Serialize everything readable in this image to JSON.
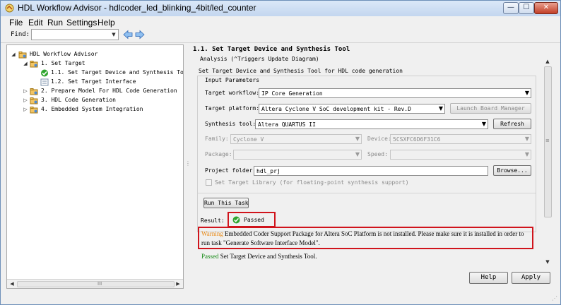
{
  "window": {
    "title": "HDL Workflow Advisor - hdlcoder_led_blinking_4bit/led_counter",
    "minimize_glyph": "—",
    "maximize_glyph": "☐",
    "close_glyph": "✕"
  },
  "menu": [
    "File",
    "Edit",
    "Run",
    "Settings",
    "Help"
  ],
  "find": {
    "label": "Find:",
    "value": "",
    "back_icon": "arrow-left-icon",
    "forward_icon": "arrow-right-icon"
  },
  "tree": [
    {
      "label": "HDL Workflow Advisor",
      "expander": "◢",
      "icon": "folder-icon"
    },
    {
      "label": "1. Set Target",
      "expander": "◢",
      "icon": "folder-icon"
    },
    {
      "label": "1.1. Set Target Device and Synthesis Tool",
      "expander": "",
      "icon": "check-passed-icon"
    },
    {
      "label": "1.2. Set Target Interface",
      "expander": "",
      "icon": "task-icon"
    },
    {
      "label": "2. Prepare Model For HDL Code Generation",
      "expander": "▷",
      "icon": "folder-icon"
    },
    {
      "label": "3. HDL Code Generation",
      "expander": "▷",
      "icon": "folder-icon"
    },
    {
      "label": "4. Embedded System Integration",
      "expander": "▷",
      "icon": "folder-icon"
    }
  ],
  "content": {
    "heading": "1.1. Set Target Device and Synthesis Tool",
    "analysis": "Analysis (^Triggers Update Diagram)",
    "description": "Set Target Device and Synthesis Tool for HDL code generation",
    "input_params_title": "Input Parameters",
    "target_workflow_label": "Target workflow:",
    "target_workflow_value": "IP Core Generation",
    "target_platform_label": "Target platform:",
    "target_platform_value": "Altera Cyclone V SoC development kit - Rev.D",
    "launch_board_manager": "Launch Board Manager",
    "synthesis_tool_label": "Synthesis tool:",
    "synthesis_tool_value": "Altera QUARTUS II",
    "refresh": "Refresh",
    "family_label": "Family:",
    "family_value": "Cyclone V",
    "device_label": "Device:",
    "device_value": "5CSXFC6D6F31C6",
    "package_label": "Package:",
    "package_value": "",
    "speed_label": "Speed:",
    "speed_value": "",
    "project_folder_label": "Project folder:",
    "project_folder_value": "hdl_prj",
    "browse": "Browse...",
    "set_target_library": "Set Target Library (for floating-point synthesis support)",
    "run_task": "Run This Task",
    "result_label": "Result:",
    "result_value": "Passed",
    "warning_word": "Warning",
    "warning_text": "Embedded Coder Support Package for Altera SoC Platform is not installed. Please make sure it is installed in order to run task \"Generate Software Interface Model\".",
    "passed_word": "Passed",
    "passed_text": "Set Target Device and Synthesis Tool."
  },
  "buttons": {
    "help": "Help",
    "apply": "Apply"
  },
  "scroll": {
    "h_grip": "III",
    "v_grip": "≡",
    "left": "◀",
    "right": "▶",
    "up": "▲",
    "down": "▼"
  },
  "colors": {
    "warning": "#e98a16",
    "passed": "#168a16",
    "highlight_box": "#d0141c"
  }
}
